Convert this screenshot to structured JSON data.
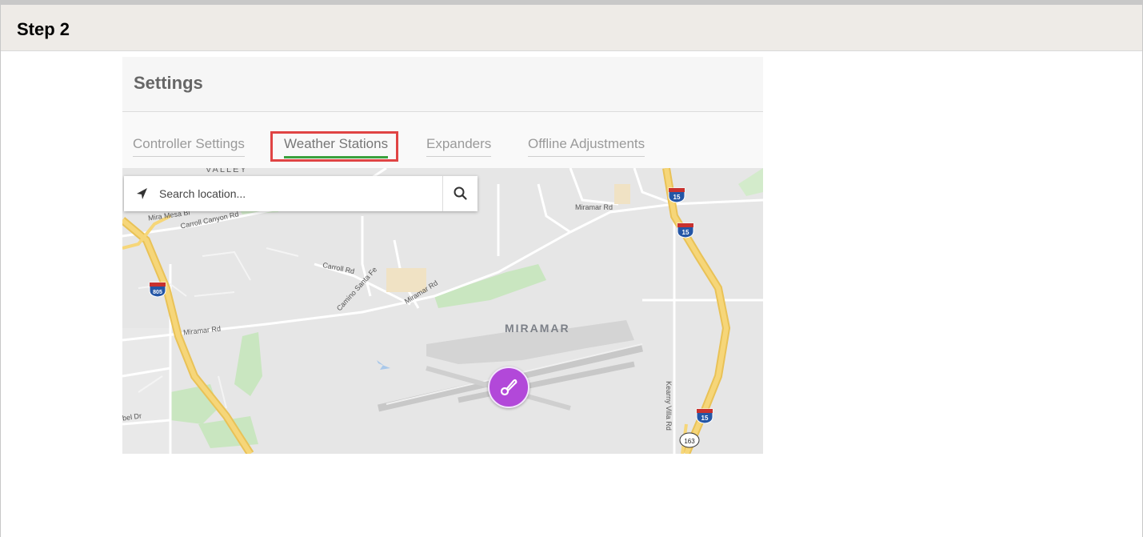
{
  "step": {
    "title": "Step 2"
  },
  "settings": {
    "title": "Settings",
    "tabs": [
      {
        "label": "Controller Settings",
        "active": false
      },
      {
        "label": "Weather Stations",
        "active": true
      },
      {
        "label": "Expanders",
        "active": false
      },
      {
        "label": "Offline Adjustments",
        "active": false
      }
    ]
  },
  "map": {
    "search": {
      "placeholder": "Search location..."
    },
    "labels": {
      "valley": "VALLEY",
      "mira_mesa": "Mira Mesa Bl",
      "carroll_canyon": "Carroll Canyon Rd",
      "carroll_rd": "Carroll Rd",
      "camino_santa_fe": "Camino Santa Fe",
      "miramar_rd_center": "Miramar Rd",
      "miramar_rd_left": "Miramar Rd",
      "miramar_rd_top": "Miramar Rd",
      "miramar": "MIRAMAR",
      "kearny_villa": "Kearny Villa Rd",
      "bel_dr": "bel Dr"
    },
    "shields": {
      "i805": "805",
      "i15": "15",
      "sr163": "163"
    },
    "marker_icon": "weather-station-sensor-icon"
  },
  "colors": {
    "highlight": "#e04444",
    "active_tab": "#3ba13e",
    "marker": "#b248d9",
    "highway": "#f4d06a"
  }
}
